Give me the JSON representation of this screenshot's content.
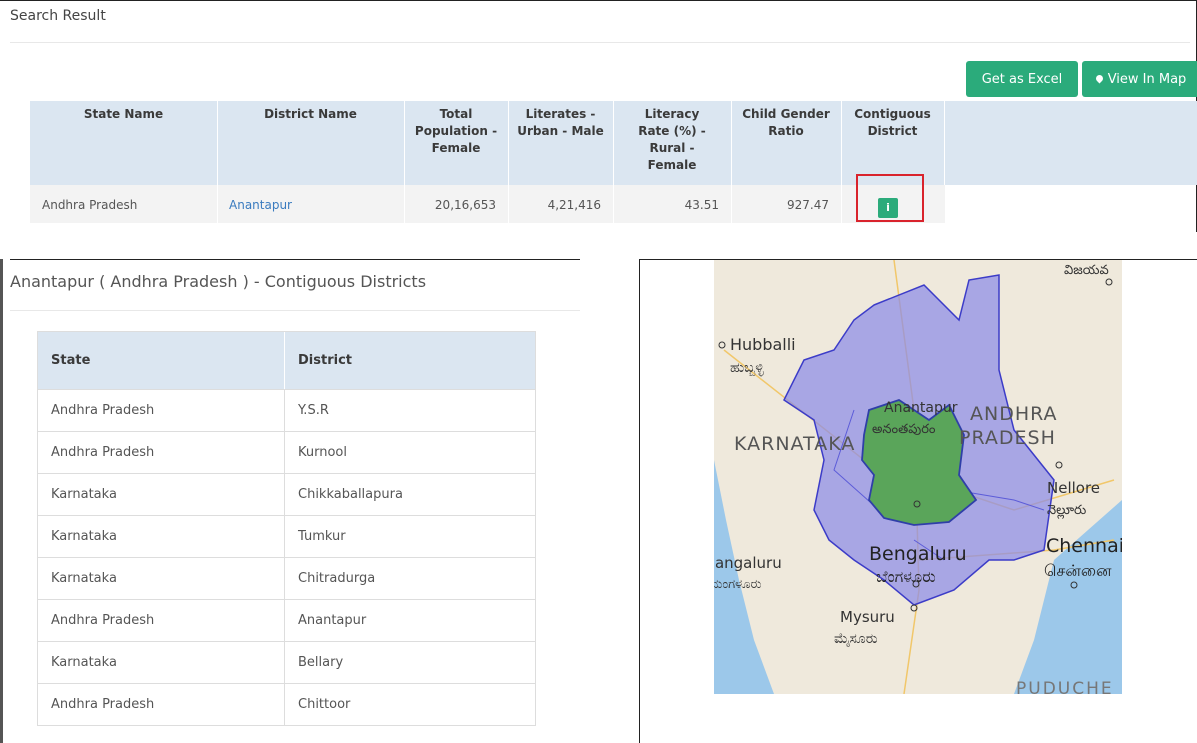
{
  "search": {
    "title": "Search Result"
  },
  "buttons": {
    "excel": "Get as Excel",
    "map": "View In Map"
  },
  "results": {
    "headers": [
      "State Name",
      "District Name",
      "Total Population - Female",
      "Literates - Urban - Male",
      "Literacy Rate (%) - Rural - Female",
      "Child Gender Ratio",
      "Contiguous District"
    ],
    "header_lines": {
      "total": [
        "Total",
        "Population -",
        "Female"
      ],
      "literates": [
        "Literates -",
        "Urban - Male"
      ],
      "literacy": [
        "Literacy",
        "Rate (%) -",
        "Rural -",
        "Female"
      ],
      "child": [
        "Child Gender",
        "Ratio"
      ],
      "contig": [
        "Contiguous",
        "District"
      ]
    },
    "row": {
      "state": "Andhra Pradesh",
      "district": "Anantapur",
      "total": "20,16,653",
      "literates": "4,21,416",
      "literacy": "43.51",
      "child": "927.47",
      "info": "i"
    }
  },
  "contiguous": {
    "title": "Anantapur ( Andhra Pradesh ) - Contiguous Districts",
    "headers": {
      "state": "State",
      "district": "District"
    },
    "rows": [
      {
        "state": "Andhra Pradesh",
        "district": "Y.S.R"
      },
      {
        "state": "Andhra Pradesh",
        "district": "Kurnool"
      },
      {
        "state": "Karnataka",
        "district": "Chikkaballapura"
      },
      {
        "state": "Karnataka",
        "district": "Tumkur"
      },
      {
        "state": "Karnataka",
        "district": "Chitradurga"
      },
      {
        "state": "Andhra Pradesh",
        "district": "Anantapur"
      },
      {
        "state": "Karnataka",
        "district": "Bellary"
      },
      {
        "state": "Andhra Pradesh",
        "district": "Chittoor"
      }
    ]
  },
  "map_labels": {
    "hubballi": "Hubballi",
    "hubballi_kn": "ಹುಬ್ಬಳ್ಳಿ",
    "karnataka": "KARNATAKA",
    "anantapur": "Anantapur",
    "anantapur_te": "అనంతపురం",
    "andhra": "ANDHRA",
    "pradesh": "PRADESH",
    "nellore": "Nellore",
    "nellore_te": "నెల్లూరు",
    "bengaluru": "Bengaluru",
    "bengaluru_kn": "ಬೆಂಗಳೂರು",
    "chennai": "Chennai",
    "chennai_ta": "சென்னை",
    "mangaluru": "Mangaluru",
    "mangaluru_kn": "ಮಂಗಳೂರು",
    "mysuru": "Mysuru",
    "mysuru_kn": "ಮೈಸೂರು",
    "puducherry": "PUDUCHE",
    "vijayawada_te": "విజయవ"
  },
  "colors": {
    "accent": "#2bab7b",
    "header_bg": "#dbe6f1",
    "highlight_border": "#d9232c",
    "link": "#3a7bbf",
    "map_region_fill": "#8c8ce8",
    "map_district_fill": "#5aa55a"
  },
  "icons": {
    "map_button": "map-marker-icon",
    "info": "info-icon"
  }
}
